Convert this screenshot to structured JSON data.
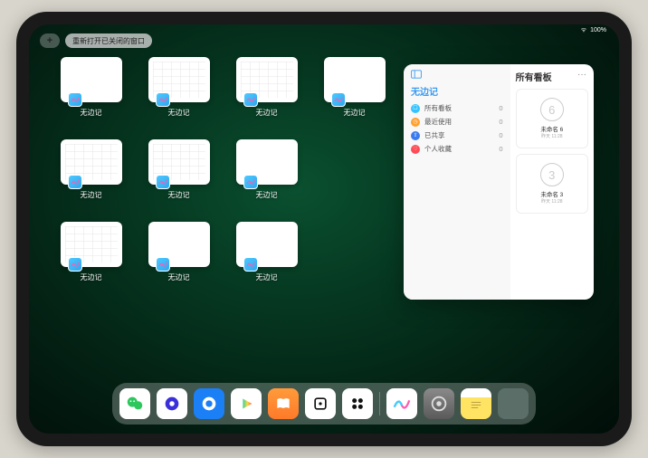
{
  "status": {
    "wifi": "ᯤ",
    "battery_text": "100%"
  },
  "topbar": {
    "add_label": "+",
    "reopen_label": "重新打开已关闭的窗口"
  },
  "app_label": "无边记",
  "grid_variants": [
    "blank",
    "grid",
    "grid",
    "blank",
    "grid",
    "grid",
    "blank",
    "grid",
    "grid",
    "blank",
    "blank",
    "grid"
  ],
  "popover": {
    "left_title": "无边记",
    "right_title": "所有看板",
    "ellipsis": "···",
    "categories": [
      {
        "name": "所有看板",
        "color": "#34c3ff",
        "glyph": "☐",
        "count": 0
      },
      {
        "name": "最近使用",
        "color": "#ff9f2e",
        "glyph": "◷",
        "count": 0
      },
      {
        "name": "已共享",
        "color": "#3a7bf0",
        "glyph": "⇧",
        "count": 0
      },
      {
        "name": "个人收藏",
        "color": "#ff4b55",
        "glyph": "♡",
        "count": 0
      }
    ],
    "boards": [
      {
        "sketch": "6",
        "name": "未命名 6",
        "date": "昨天 11:28"
      },
      {
        "sketch": "3",
        "name": "未命名 3",
        "date": "昨天 11:28"
      }
    ]
  },
  "dock": [
    {
      "id": "wechat",
      "cls": "di-wechat"
    },
    {
      "id": "quark",
      "cls": "di-purple"
    },
    {
      "id": "browser",
      "cls": "di-blue"
    },
    {
      "id": "play",
      "cls": "di-play"
    },
    {
      "id": "books",
      "cls": "di-books"
    },
    {
      "id": "app-a",
      "cls": "di-white"
    },
    {
      "id": "app-b",
      "cls": "di-white"
    },
    {
      "id": "freeform",
      "cls": "di-freeform"
    },
    {
      "id": "settings",
      "cls": "di-settings"
    },
    {
      "id": "notes",
      "cls": "di-notes"
    },
    {
      "id": "folder",
      "cls": "di-folder"
    }
  ]
}
